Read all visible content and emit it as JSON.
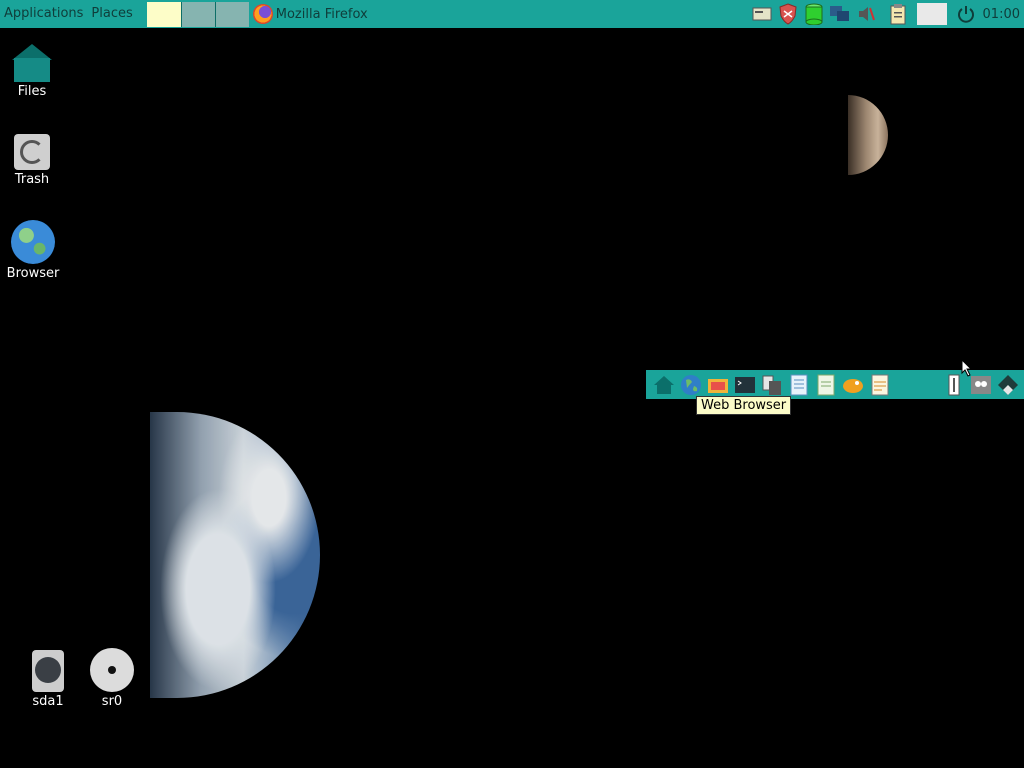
{
  "top_panel": {
    "menu_applications": "Applications",
    "menu_places": "Places",
    "workspaces": [
      "workspace-1",
      "workspace-2",
      "workspace-3"
    ],
    "task_label": "Mozilla Firefox",
    "clock": "01:00"
  },
  "desktop": {
    "icons": {
      "files": "Files",
      "trash": "Trash",
      "browser": "Browser",
      "sda1": "sda1",
      "sr0": "sr0"
    }
  },
  "launcher": {
    "tooltip": "Web Browser"
  },
  "colors": {
    "panel": "#1aa49a",
    "tooltip_bg": "#fcfcc8",
    "desktop_bg": "#000000"
  }
}
